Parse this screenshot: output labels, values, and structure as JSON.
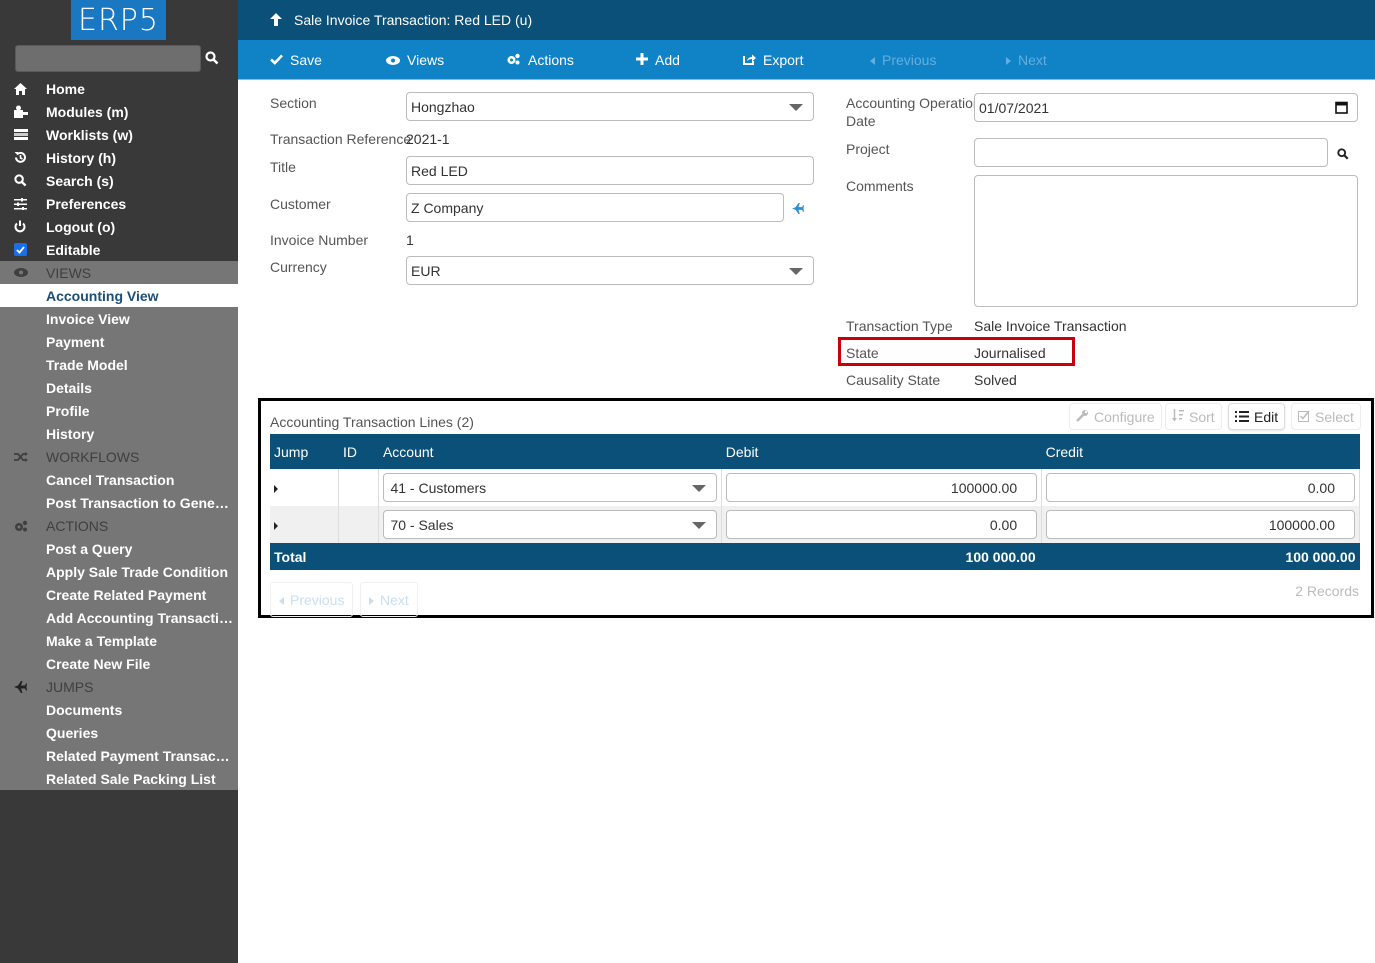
{
  "sidebar": {
    "logo": "ERP5",
    "search_placeholder": "",
    "nav": [
      {
        "label": "Home",
        "icon": "home-icon"
      },
      {
        "label": "Modules (m)",
        "icon": "puzzle-icon"
      },
      {
        "label": "Worklists (w)",
        "icon": "tasks-icon"
      },
      {
        "label": "History (h)",
        "icon": "history-icon"
      },
      {
        "label": "Search (s)",
        "icon": "search-icon"
      },
      {
        "label": "Preferences",
        "icon": "sliders-icon"
      },
      {
        "label": "Logout (o)",
        "icon": "power-icon"
      },
      {
        "label": "Editable",
        "icon": "checkbox-icon",
        "checked": true
      }
    ],
    "views_header": "VIEWS",
    "views": [
      "Accounting View",
      "Invoice View",
      "Payment",
      "Trade Model",
      "Details",
      "Profile",
      "History"
    ],
    "active_view": "Accounting View",
    "workflows_header": "WORKFLOWS",
    "workflows": [
      "Cancel Transaction",
      "Post Transaction to General L..."
    ],
    "actions_header": "ACTIONS",
    "actions": [
      "Post a Query",
      "Apply Sale Trade Condition",
      "Create Related Payment",
      "Add Accounting Transaction L...",
      "Make a Template",
      "Create New File"
    ],
    "jumps_header": "JUMPS",
    "jumps": [
      "Documents",
      "Queries",
      "Related Payment Transaction",
      "Related Sale Packing List"
    ]
  },
  "header": {
    "title": "Sale Invoice Transaction: Red LED (u)"
  },
  "toolbar": {
    "save": "Save",
    "views": "Views",
    "actions": "Actions",
    "add": "Add",
    "export": "Export",
    "previous": "Previous",
    "next": "Next"
  },
  "form": {
    "section_label": "Section",
    "section_value": "Hongzhao",
    "reference_label": "Transaction Reference",
    "reference_value": "2021-1",
    "title_label": "Title",
    "title_value": "Red LED",
    "customer_label": "Customer",
    "customer_value": "Z Company",
    "invoice_number_label": "Invoice Number",
    "invoice_number_value": "1",
    "currency_label": "Currency",
    "currency_value": "EUR",
    "date_label_1": "Accounting Operation",
    "date_label_2": "Date",
    "date_value": "01/07/2021",
    "project_label": "Project",
    "project_value": "",
    "comments_label": "Comments",
    "comments_value": "",
    "type_label": "Transaction Type",
    "type_value": "Sale Invoice Transaction",
    "state_label": "State",
    "state_value": "Journalised",
    "causality_label": "Causality State",
    "causality_value": "Solved"
  },
  "listbox": {
    "title": "Accounting Transaction Lines (2)",
    "buttons": {
      "configure": "Configure",
      "sort": "Sort",
      "edit": "Edit",
      "select": "Select"
    },
    "columns": [
      "Jump",
      "ID",
      "Account",
      "Debit",
      "Credit"
    ],
    "rows": [
      {
        "id": "",
        "account": "41 - Customers",
        "debit": "100000.00",
        "credit": "0.00"
      },
      {
        "id": "",
        "account": "70 - Sales",
        "debit": "0.00",
        "credit": "100000.00"
      }
    ],
    "total_label": "Total",
    "total_debit": "100 000.00",
    "total_credit": "100 000.00",
    "previous": "Previous",
    "next": "Next",
    "records": "2 Records"
  },
  "colors": {
    "header_dark": "#0a5078",
    "toolbar_blue": "#1082c6",
    "sidebar_bg": "#393939",
    "sidebar_section": "#767676",
    "highlight_red": "#c8000a"
  }
}
